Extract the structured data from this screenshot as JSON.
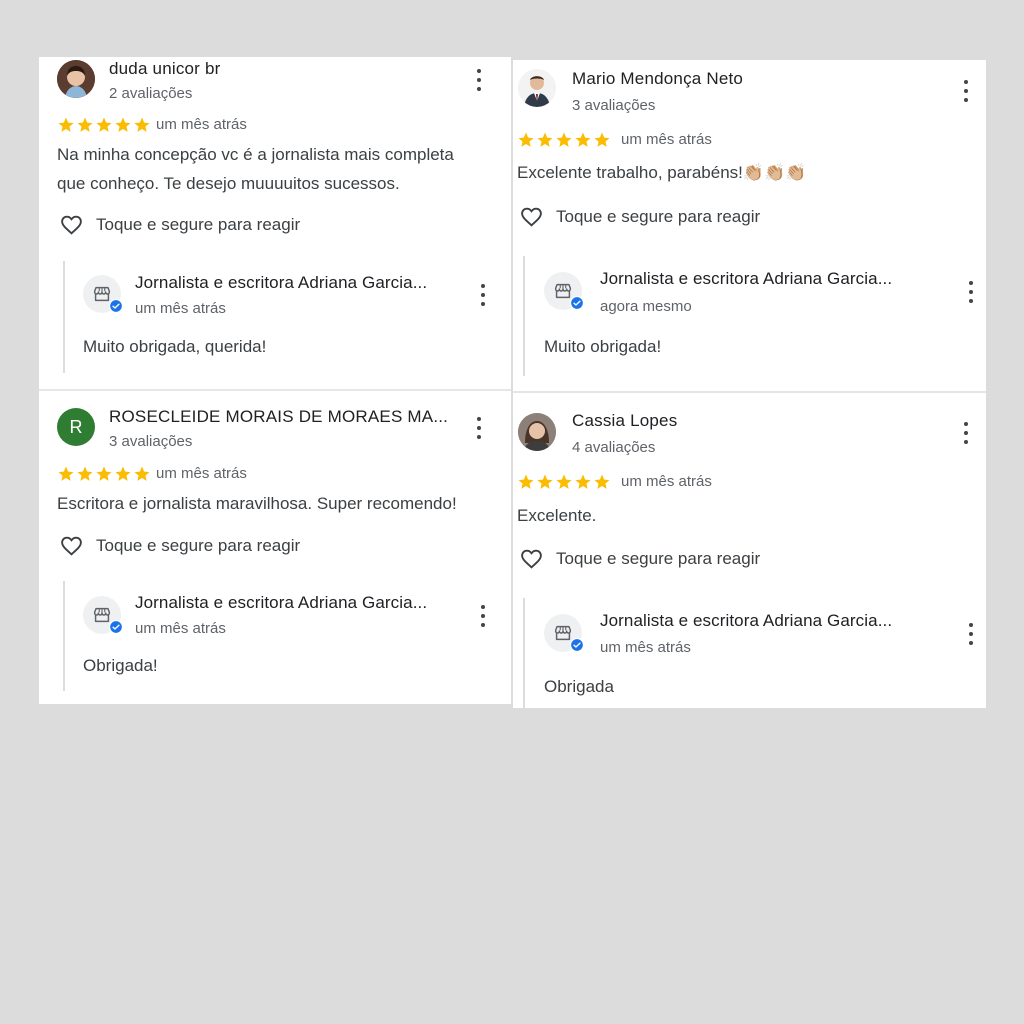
{
  "colors": {
    "star": "#fbbc04",
    "verified": "#1a73e8",
    "avatar_green": "#2e7d32"
  },
  "react_label": "Toque e segure para reagir",
  "left": {
    "reviews": [
      {
        "name": "duda unicor br",
        "count": "2 avaliações",
        "date": "um mês atrás",
        "text_lines": [
          "Na minha concepção vc é a jornalista mais completa",
          "que conheço. Te desejo muuuuitos sucessos."
        ],
        "owner": {
          "name": "Jornalista e escritora Adriana Garcia...",
          "date": "um mês atrás",
          "text": "Muito obrigada, querida!"
        }
      },
      {
        "name": "ROSECLEIDE MORAIS DE MORAES MA...",
        "avatar_letter": "R",
        "count": "3 avaliações",
        "date": "um mês atrás",
        "text_lines": [
          "Escritora e jornalista maravilhosa. Super recomendo!"
        ],
        "owner": {
          "name": "Jornalista e escritora Adriana Garcia...",
          "date": "um mês atrás",
          "text": "Obrigada!"
        }
      }
    ]
  },
  "right": {
    "reviews": [
      {
        "name": "Mario Mendonça Neto",
        "count": "3 avaliações",
        "date": "um mês atrás",
        "text_lines": [
          "Excelente trabalho, parabéns!👏🏼👏🏼👏🏼"
        ],
        "owner": {
          "name": "Jornalista e escritora Adriana Garcia...",
          "date": "agora mesmo",
          "text": "Muito obrigada!"
        }
      },
      {
        "name": "Cassia Lopes",
        "count": "4 avaliações",
        "date": "um mês atrás",
        "text_lines": [
          "Excelente."
        ],
        "owner": {
          "name": "Jornalista e escritora Adriana Garcia...",
          "date": "um mês atrás",
          "text": "Obrigada"
        }
      }
    ]
  }
}
